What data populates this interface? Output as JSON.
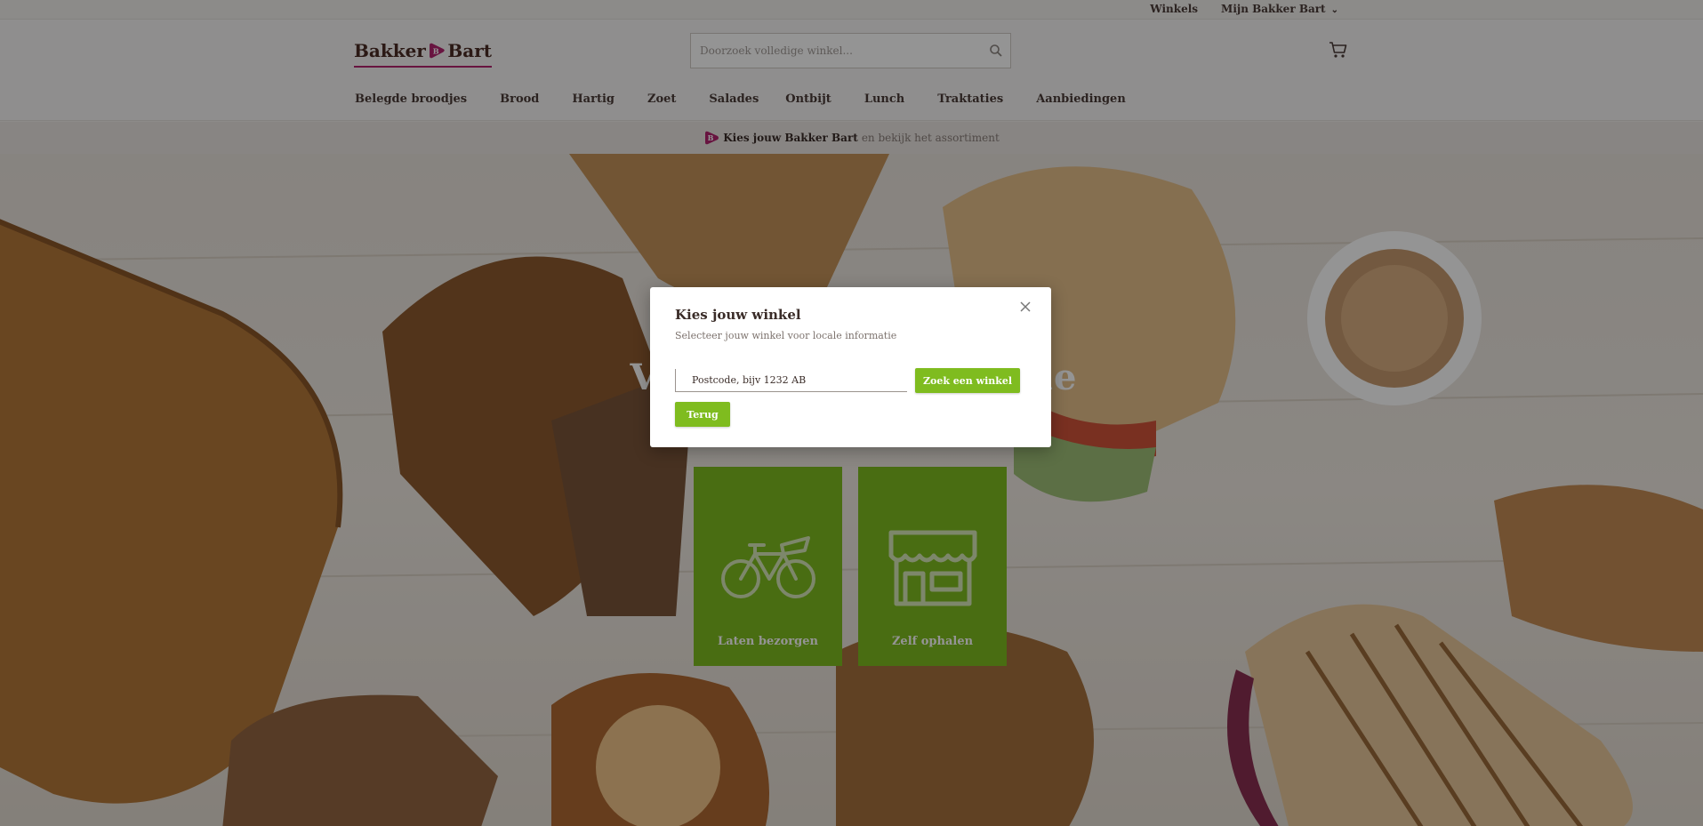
{
  "topbar": {
    "stores_label": "Winkels",
    "account_label": "Mijn Bakker Bart"
  },
  "header": {
    "logo_left": "Bakker",
    "logo_right": "Bart",
    "search_placeholder": "Doorzoek volledige winkel..."
  },
  "nav": {
    "items": [
      {
        "label": "Belegde broodjes"
      },
      {
        "label": "Brood"
      },
      {
        "label": "Hartig"
      },
      {
        "label": "Zoet"
      },
      {
        "label": "Salades"
      },
      {
        "label": "Ontbijt"
      },
      {
        "label": "Lunch"
      },
      {
        "label": "Traktaties"
      },
      {
        "label": "Aanbiedingen"
      }
    ]
  },
  "banner": {
    "strong": "Kies jouw Bakker Bart",
    "text": "en bekijk het assortiment"
  },
  "hero": {
    "title_left": "Vi",
    "title_right": "de",
    "tiles": [
      {
        "label": "Laten bezorgen",
        "icon": "bicycle-icon"
      },
      {
        "label": "Zelf ophalen",
        "icon": "storefront-icon"
      }
    ]
  },
  "modal": {
    "title": "Kies jouw winkel",
    "subtitle": "Selecteer jouw winkel voor locale informatie",
    "postcode_placeholder": "Postcode, bijv 1232 AB",
    "search_button": "Zoek een winkel",
    "back_button": "Terug"
  },
  "colors": {
    "brand_magenta": "#b4246e",
    "brand_green": "#7fbc1f",
    "text_dark": "#3a2c28"
  }
}
